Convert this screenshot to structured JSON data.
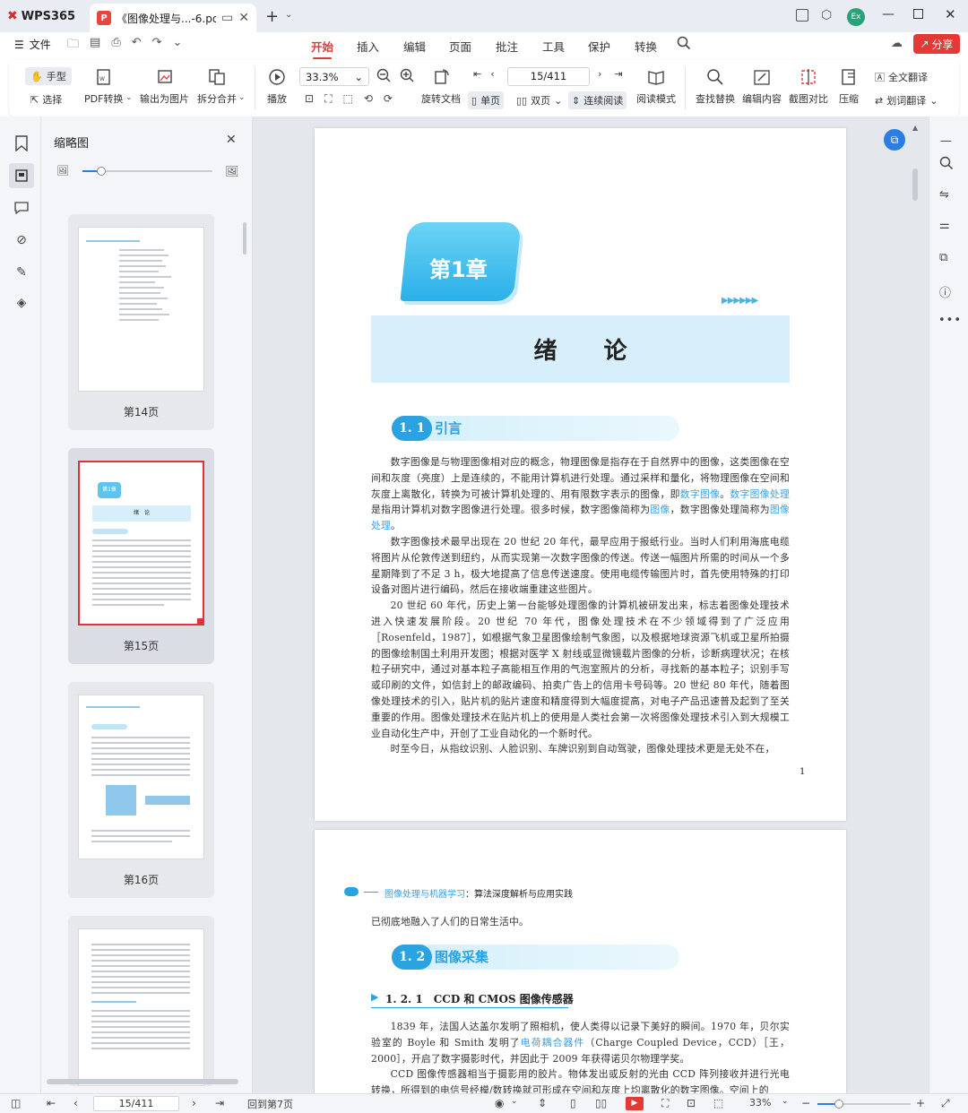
{
  "titlebar": {
    "app": "WPS365",
    "tab_name": "《图像处理与...-6.pdf",
    "avatar_text": "Ex"
  },
  "menu": {
    "hamburger_label": "文件",
    "tabs": [
      "开始",
      "插入",
      "编辑",
      "页面",
      "批注",
      "工具",
      "保护",
      "转换"
    ],
    "active_tab": "开始",
    "share": "分享"
  },
  "toolbar": {
    "hand": "手型",
    "select": "选择",
    "pdf_convert": "PDF转换",
    "to_image": "输出为图片",
    "split_merge": "拆分合并",
    "play": "播放",
    "zoom": "33.3%",
    "page_field": "15/411",
    "rotate": "旋转文档",
    "single": "单页",
    "double": "双页",
    "continuous": "连续阅读",
    "read_mode": "阅读模式",
    "find_replace": "查找替换",
    "edit_content": "编辑内容",
    "compare": "截图对比",
    "compress": "压缩",
    "full_translate": "全文翻译",
    "word_translate": "划词翻译"
  },
  "thumbnails": {
    "title": "缩略图",
    "pages": [
      "第14页",
      "第15页",
      "第16页"
    ],
    "selected": "第15页"
  },
  "page15": {
    "chapter_badge": "第1章",
    "chapter_title": "绪　　论",
    "section_num": "1. 1",
    "section_title": "引言",
    "page_number": "1",
    "p1_a": "数字图像是与物理图像相对应的概念，物理图像是指存在于自然界中的图像，这类图像在空间和灰度（亮度）上是连续的，不能用计算机进行处理。通过采样和量化，将物理图像在空间和灰度上离散化，转换为可被计算机处理的、用有限数字表示的图像，即",
    "p1_l1": "数字图像",
    "p1_b": "。",
    "p1_l2": "数字图像处理",
    "p1_c": "是指用计算机对数字图像进行处理。很多时候，数字图像简称为",
    "p1_l3": "图像",
    "p1_d": "，数字图像处理简称为",
    "p1_l4": "图像处理",
    "p1_e": "。",
    "p2": "数字图像技术最早出现在 20 世纪 20 年代，最早应用于报纸行业。当时人们利用海底电缆将图片从伦敦传送到纽约，从而实现第一次数字图像的传送。传送一幅图片所需的时间从一个多星期降到了不足 3 h，极大地提高了信息传送速度。使用电缆传输图片时，首先使用特殊的打印设备对图片进行编码，然后在接收端重建这些图片。",
    "p3": "20 世纪 60 年代，历史上第一台能够处理图像的计算机被研发出来，标志着图像处理技术进入快速发展阶段。20 世纪 70 年代，图像处理技术在不少领域得到了广泛应用［Rosenfeld，1987］，如根据气象卫星图像绘制气象图，以及根据地球资源飞机或卫星所拍摄的图像绘制国土利用开发图；根据对医学 X 射线或显微镜载片图像的分析，诊断病理状况；在核粒子研究中，通过对基本粒子高能相互作用的气泡室照片的分析，寻找新的基本粒子；识别手写或印刷的文件，如信封上的邮政编码、拍卖广告上的信用卡号码等。20 世纪 80 年代，随着图像处理技术的引入，贴片机的贴片速度和精度得到大幅度提高，对电子产品迅速普及起到了至关重要的作用。图像处理技术在贴片机上的使用是人类社会第一次将图像处理技术引入到大规模工业自动化生产中，开创了工业自动化的一个新时代。",
    "p4": "时至今日，从指纹识别、人脸识别、车牌识别到自动驾驶，图像处理技术更是无处不在，"
  },
  "page16": {
    "header_link": "图像处理与机器学习",
    "header_rest": "：算法深度解析与应用实践",
    "cont": "已彻底地融入了人们的日常生活中。",
    "section_num": "1. 2",
    "section_title": "图像采集",
    "subsection": "1. 2. 1　CCD 和 CMOS 图像传感器",
    "p1_a": "1839 年，法国人达盖尔发明了照相机，使人类得以记录下美好的瞬间。1970 年，贝尔实验室的 Boyle 和 Smith 发明了",
    "p1_link": "电荷耦合器件",
    "p1_b": "（Charge Coupled Device，CCD）［王，2000］，开启了数字摄影时代，并因此于 2009 年获得诺贝尔物理学奖。",
    "p2": "CCD 图像传感器相当于摄影用的胶片。物体发出或反射的光由 CCD 阵列接收并进行光电转换，所得到的电信号经模/数转换就可形成在空间和灰度上均离散化的数字图像。空间上的"
  },
  "status": {
    "page_field": "15/411",
    "back_label": "回到第7页",
    "zoom": "33%"
  },
  "colors": {
    "accent": "#e53935",
    "blue": "#2aa3e0",
    "chapter_bg": "#d6effa"
  }
}
